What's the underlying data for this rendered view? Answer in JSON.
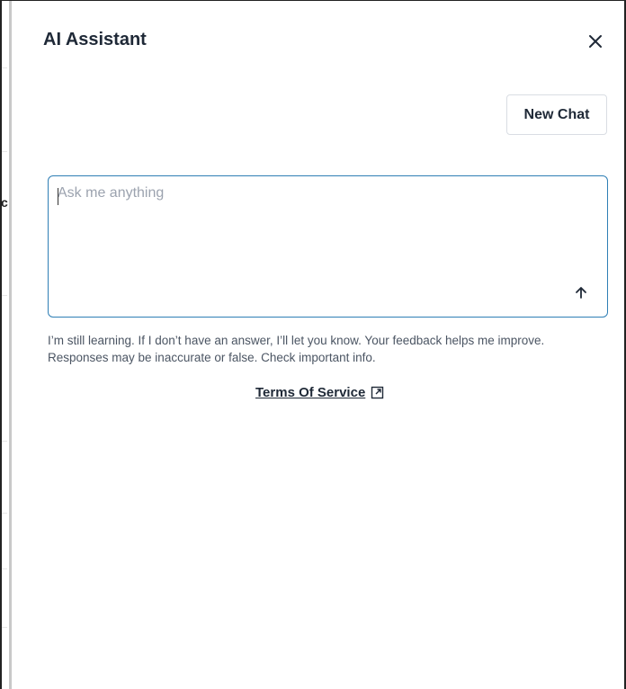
{
  "background": {
    "partial_text": "c"
  },
  "panel": {
    "title": "AI Assistant",
    "close_icon": "close-icon",
    "new_chat_label": "New Chat",
    "input": {
      "placeholder": "Ask me anything",
      "value": "",
      "send_icon": "arrow-up-icon"
    },
    "disclaimer": "I’m still learning. If I don’t have an answer, I’ll let you know. Your feedback helps me improve. Responses may be inaccurate or false. Check important info.",
    "terms_label": "Terms Of Service",
    "terms_icon": "external-link-icon"
  },
  "colors": {
    "accent_border": "#2f7fb5",
    "text_primary": "#1f2937",
    "text_secondary": "#4b5563",
    "placeholder": "#9ca3af"
  }
}
